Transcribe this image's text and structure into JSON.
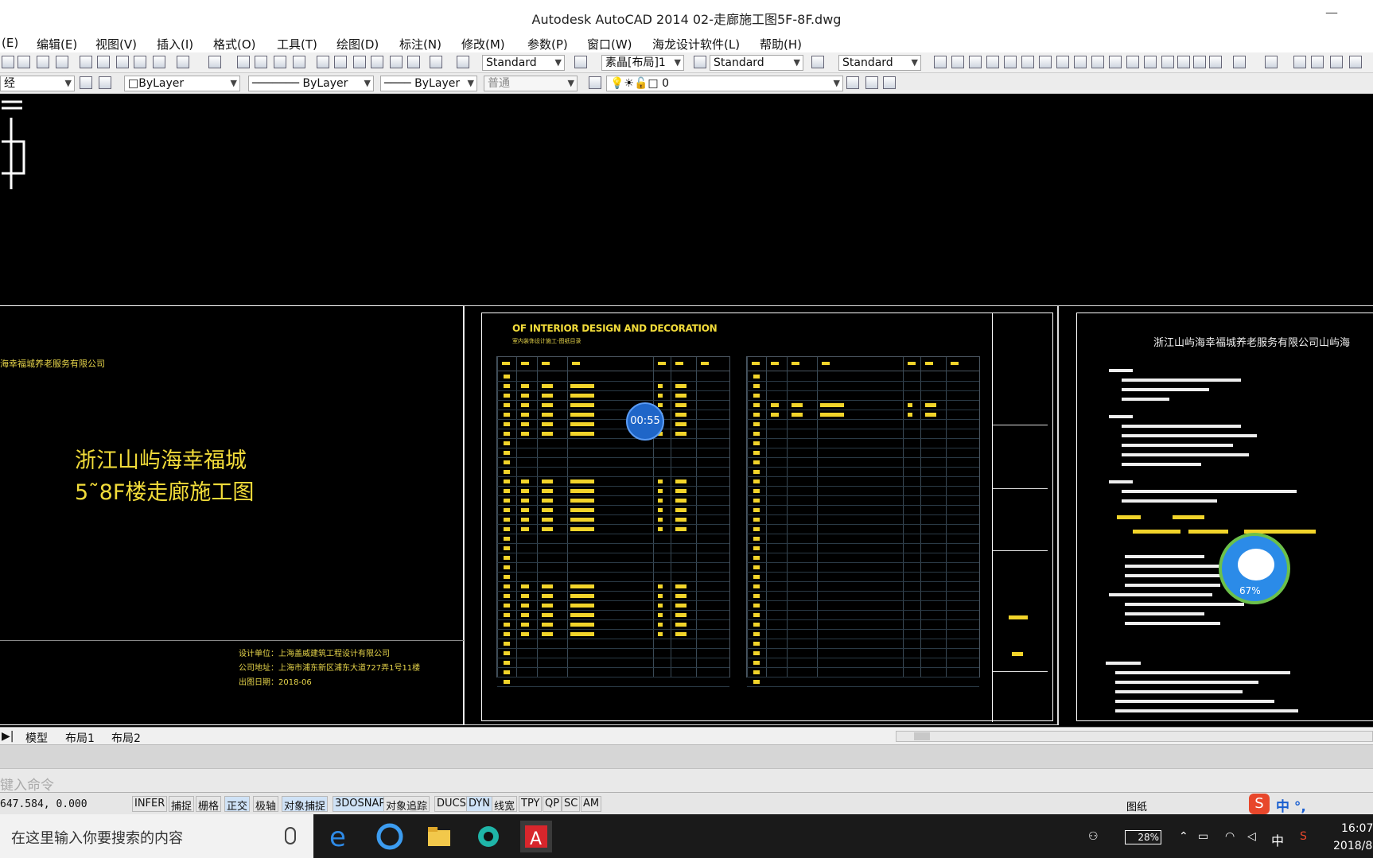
{
  "window": {
    "title": "Autodesk AutoCAD 2014    02-走廊施工图5F-8F.dwg"
  },
  "menu": [
    "(E)",
    "编辑(E)",
    "视图(V)",
    "插入(I)",
    "格式(O)",
    "工具(T)",
    "绘图(D)",
    "标注(N)",
    "修改(M)",
    "参数(P)",
    "窗口(W)",
    "海龙设计软件(L)",
    "帮助(H)"
  ],
  "toolbar1": {
    "text_style": "Standard",
    "layout_combo": "素晶[布局]1",
    "dim_style": "Standard",
    "table_style": "Standard"
  },
  "toolbar2": {
    "layer_small": "经",
    "color": "ByLayer",
    "linetype": "ByLayer",
    "lineweight": "ByLayer",
    "plotstyle": "普通",
    "layer_name": "0"
  },
  "left_sheet": {
    "company_top": "海幸福城养老服务有限公司",
    "title_line1": "浙江山屿海幸福城",
    "title_line2": "5˜8F楼走廊施工图",
    "info": [
      "设计单位：上海盖威建筑工程设计有限公司",
      "公司地址：上海市浦东新区浦东大道727弄1号11楼",
      "出图日期：2018-06"
    ]
  },
  "mid_sheet": {
    "title": "OF INTERIOR DESIGN AND DECORATION",
    "subtitle": "室内装饰设计施工-图纸目录",
    "timer": "00:55"
  },
  "right_sheet": {
    "title": "浙江山屿海幸福城养老服务有限公司山屿海",
    "progress_percent": "67%"
  },
  "layout_tabs": [
    "模型",
    "布局1",
    "布局2"
  ],
  "command": {
    "placeholder": "键入命令"
  },
  "status": {
    "coords": "647.584, 0.000",
    "toggles": [
      {
        "label": "INFER",
        "on": false
      },
      {
        "label": "捕捉",
        "on": false
      },
      {
        "label": "栅格",
        "on": false
      },
      {
        "label": "正交",
        "on": true
      },
      {
        "label": "极轴",
        "on": false
      },
      {
        "label": "对象捕捉",
        "on": true
      },
      {
        "label": "3DOSNAP",
        "on": true
      },
      {
        "label": "对象追踪",
        "on": false
      },
      {
        "label": "DUCS",
        "on": false
      },
      {
        "label": "DYN",
        "on": true
      },
      {
        "label": "线宽",
        "on": false
      },
      {
        "label": "TPY",
        "on": false
      },
      {
        "label": "QP",
        "on": false
      },
      {
        "label": "SC",
        "on": false
      },
      {
        "label": "AM",
        "on": false
      }
    ],
    "paper": "图纸"
  },
  "ime": {
    "label": "中 °,"
  },
  "taskbar": {
    "search_placeholder": "在这里输入你要搜索的内容",
    "battery": "28%",
    "ime": "中",
    "time": "16:07",
    "date": "2018/8"
  },
  "colors": {
    "accent": "#f2dc3a",
    "timer": "#1f66c8",
    "qq": "#2b8be8"
  }
}
